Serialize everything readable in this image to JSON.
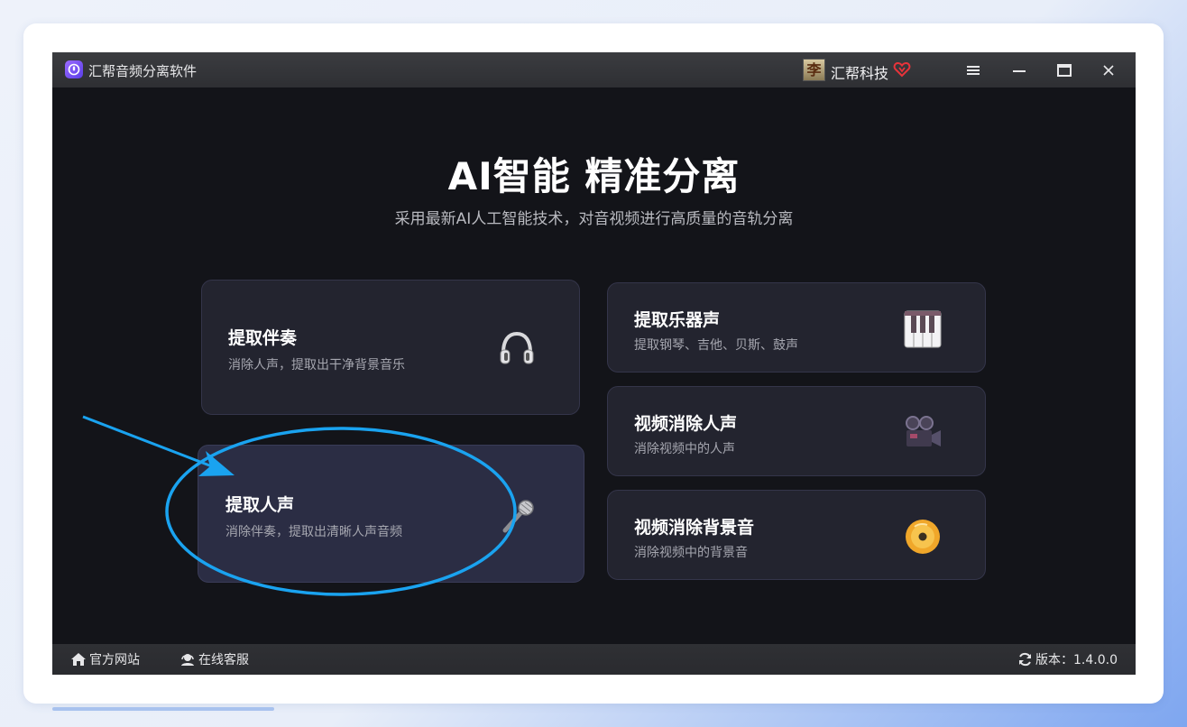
{
  "window": {
    "title": "汇帮音频分离软件"
  },
  "user": {
    "avatar_text": "李",
    "name": "汇帮科技"
  },
  "titlebar": {
    "menu_icon": "menu-icon",
    "minimize_icon": "minimize-icon",
    "maximize_icon": "maximize-icon",
    "close_icon": "close-icon"
  },
  "hero": {
    "title": "AI智能 精准分离",
    "subtitle": "采用最新AI人工智能技术，对音视频进行高质量的音轨分离"
  },
  "cards": [
    {
      "title": "提取伴奏",
      "desc": "消除人声，提取出干净背景音乐",
      "icon": "headphones-icon"
    },
    {
      "title": "提取人声",
      "desc": "消除伴奏，提取出清晰人声音频",
      "icon": "microphone-icon"
    },
    {
      "title": "提取乐器声",
      "desc": "提取钢琴、吉他、贝斯、鼓声",
      "icon": "piano-icon"
    },
    {
      "title": "视频消除人声",
      "desc": "消除视频中的人声",
      "icon": "movie-camera-icon"
    },
    {
      "title": "视频消除背景音",
      "desc": "消除视频中的背景音",
      "icon": "disc-icon"
    }
  ],
  "footer": {
    "website": "官方网站",
    "support": "在线客服",
    "version": "版本：1.4.0.0"
  },
  "colors": {
    "accent": "#1aa3f0",
    "window_bg": "#131419",
    "card_bg": "#23242f"
  }
}
